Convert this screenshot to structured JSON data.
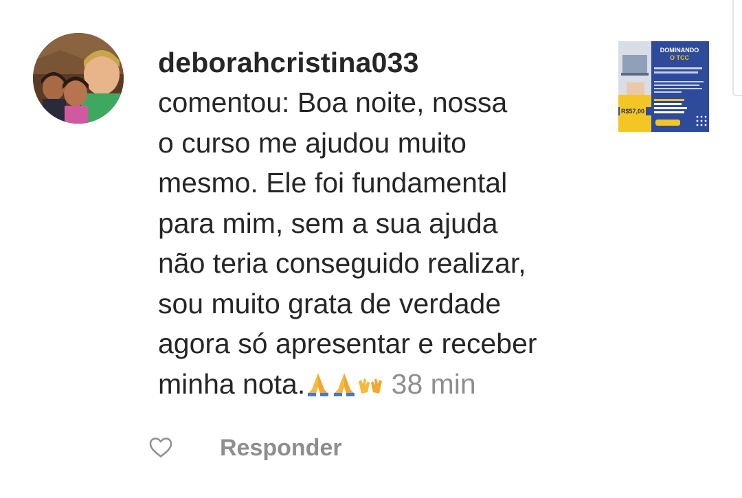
{
  "comment": {
    "username": "deborahcristina033",
    "text_lines": [
      "comentou: Boa noite, nossa",
      "o curso me ajudou muito",
      "mesmo. Ele foi fundamental",
      "para mim, sem a sua ajuda",
      "não teria conseguido realizar,",
      "sou muito grata de verdade",
      "agora só apresentar e receber",
      "minha nota."
    ],
    "emojis": [
      "folded-hands-icon",
      "folded-hands-icon",
      "open-hands-icon"
    ],
    "time": "38 min"
  },
  "post_thumbnail": {
    "title_line1": "DOMINANDO",
    "title_line2": "O TCC",
    "price": "R$57,00",
    "colors": {
      "background": "#2e4a9a",
      "accent": "#f3c623"
    }
  },
  "actions": {
    "like_icon": "heart-outline-icon",
    "reply_label": "Responder"
  }
}
